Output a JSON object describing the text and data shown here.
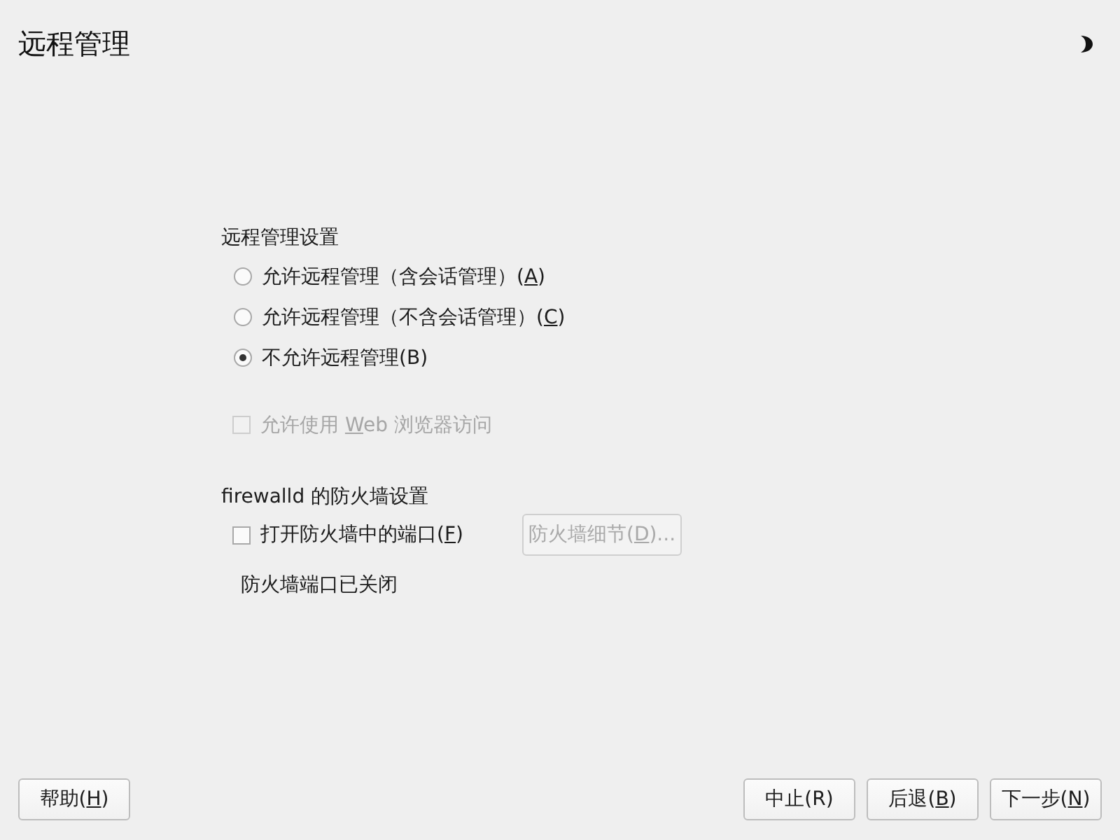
{
  "header": {
    "title": "远程管理"
  },
  "remote_admin": {
    "heading": "远程管理设置",
    "options": [
      {
        "label_before": "允许远程管理（含会话管理）(",
        "mnemonic": "A",
        "label_after": ")",
        "selected": false
      },
      {
        "label_before": "允许远程管理（不含会话管理）(",
        "mnemonic": "C",
        "label_after": ")",
        "selected": false
      },
      {
        "label_before": "不允许远程管理(B)",
        "selected": true
      }
    ]
  },
  "web_access": {
    "label_before": "允许使用 ",
    "mnemonic": "W",
    "label_after": "eb 浏览器访问",
    "checked": false,
    "disabled": true
  },
  "firewall": {
    "heading": "firewalld 的防火墙设置",
    "open_port": {
      "label_before": "打开防火墙中的端口(",
      "mnemonic": "F",
      "label_after": ")",
      "checked": false,
      "disabled": false
    },
    "details_button": {
      "label_before": "防火墙细节(",
      "mnemonic": "D",
      "label_after": ")...",
      "disabled": true
    },
    "status": "防火墙端口已关闭"
  },
  "footer": {
    "help_button": {
      "label_before": "帮助(",
      "mnemonic": "H",
      "label_after": ")",
      "disabled": false
    },
    "buttons": [
      {
        "label_before": "中止(R)",
        "disabled": false
      },
      {
        "label_before": "后退(",
        "mnemonic": "B",
        "label_after": ")",
        "disabled": false
      },
      {
        "label_before": "下一步(",
        "mnemonic": "N",
        "label_after": ")",
        "disabled": false
      }
    ]
  }
}
